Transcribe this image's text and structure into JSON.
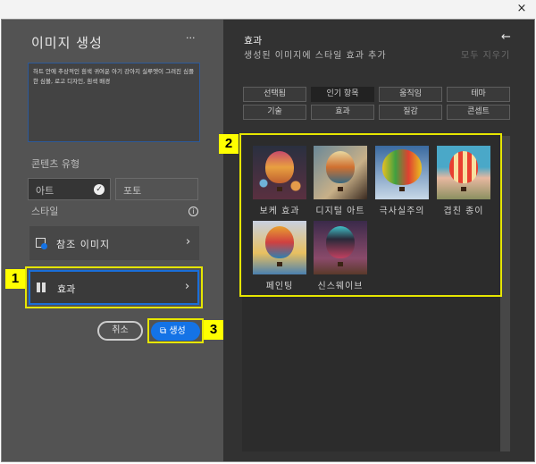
{
  "window": {
    "close_icon": "×"
  },
  "left": {
    "title": "이미지 생성",
    "more": "···",
    "prompt": "하트 안에 추상적인 흰색 귀여운 아기 강아지 실루엣이 그려진 심플한 심볼, 로고 디자인, 흰색 배경",
    "content_type_label": "콘텐츠 유형",
    "art": "아트",
    "photo": "포토",
    "style_label": "스타일",
    "info_icon": "i",
    "reference_image": "참조 이미지",
    "effects": "효과",
    "cancel": "취소",
    "generate": "생성"
  },
  "right": {
    "title": "효과",
    "subtitle": "생성된 이미지에 스타일 효과 추가",
    "clear_all": "모두 지우기",
    "tabs": [
      "선택됨",
      "인기 항목",
      "움직임",
      "테마",
      "기술",
      "효과",
      "질감",
      "콘셉트"
    ],
    "items": [
      "보케 효과",
      "디지털 아트",
      "극사실주의",
      "겹친 종이",
      "페인팅",
      "신스웨이브"
    ]
  },
  "callouts": [
    "1",
    "2",
    "3"
  ],
  "colors": {
    "accent": "#1473e6",
    "highlight": "#ffff00"
  }
}
